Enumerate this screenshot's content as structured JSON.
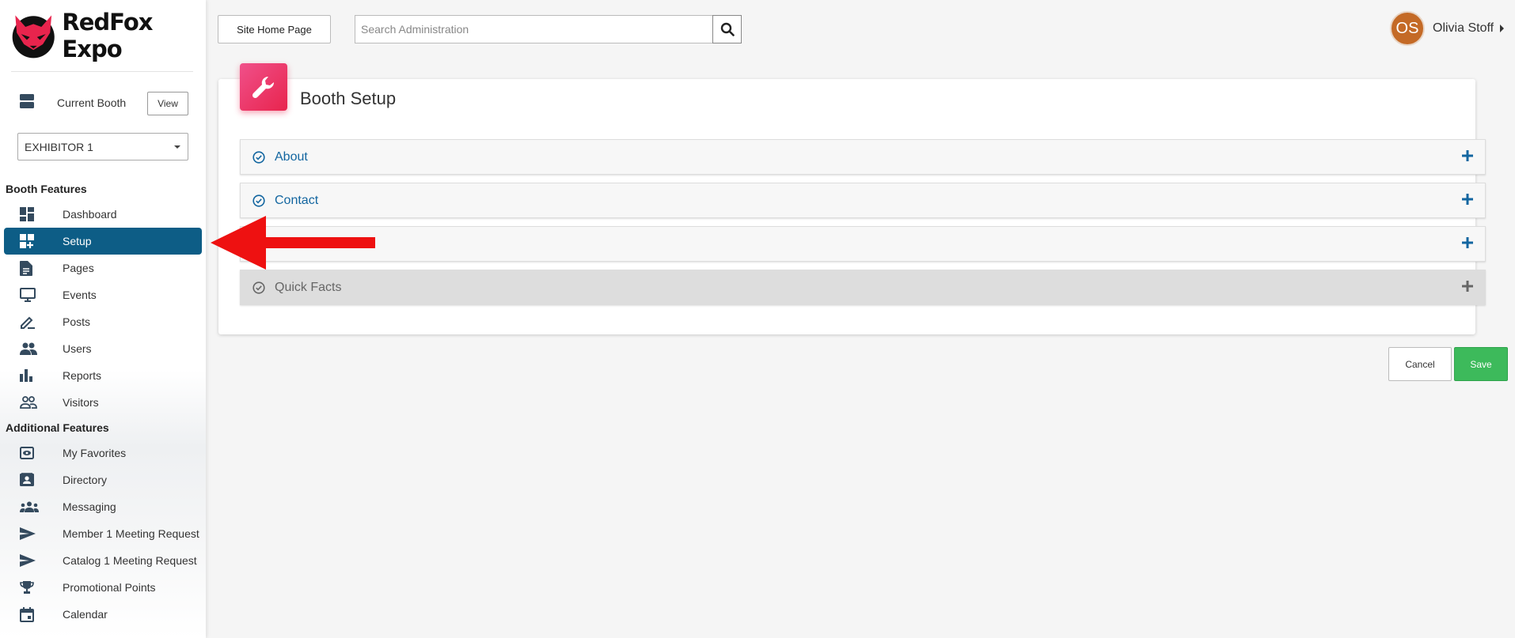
{
  "brand": {
    "name": "RedFox Expo",
    "logo_icon": "fox-head-logo",
    "accent": "#e8244d"
  },
  "sidebar": {
    "current_booth_label": "Current Booth",
    "view_label": "View",
    "booth_select_value": "EXHIBITOR 1",
    "booth_features_heading": "Booth Features",
    "booth_features": [
      {
        "label": "Dashboard",
        "icon": "dashboard-icon",
        "active": false
      },
      {
        "label": "Setup",
        "icon": "dashboard-add-icon",
        "active": true
      },
      {
        "label": "Pages",
        "icon": "document-icon",
        "active": false
      },
      {
        "label": "Events",
        "icon": "monitor-icon",
        "active": false
      },
      {
        "label": "Posts",
        "icon": "pen-icon",
        "active": false
      },
      {
        "label": "Users",
        "icon": "users-icon",
        "active": false
      },
      {
        "label": "Reports",
        "icon": "bar-chart-icon",
        "active": false
      },
      {
        "label": "Visitors",
        "icon": "visitors-icon",
        "active": false
      }
    ],
    "additional_features_heading": "Additional Features",
    "additional_features": [
      {
        "label": "My Favorites",
        "icon": "eye-icon"
      },
      {
        "label": "Directory",
        "icon": "contact-card-icon"
      },
      {
        "label": "Messaging",
        "icon": "group-icon"
      },
      {
        "label": "Member 1 Meeting Request",
        "icon": "send-icon"
      },
      {
        "label": "Catalog 1 Meeting Request",
        "icon": "send-icon"
      },
      {
        "label": "Promotional Points",
        "icon": "trophy-icon"
      },
      {
        "label": "Calendar",
        "icon": "calendar-icon"
      }
    ],
    "active_color": "#0d5d86"
  },
  "topbar": {
    "site_home_label": "Site Home Page",
    "search_placeholder": "Search Administration",
    "user_initials": "OS",
    "user_name": "Olivia Stoff",
    "avatar_color": "#c46a26"
  },
  "main": {
    "title": "Booth Setup",
    "title_icon": "wrench-icon",
    "sections": [
      {
        "label": "About",
        "enabled": true
      },
      {
        "label": "Contact",
        "enabled": true
      },
      {
        "label": "",
        "enabled": true
      },
      {
        "label": "Quick Facts",
        "enabled": false
      }
    ],
    "cancel_label": "Cancel",
    "save_label": "Save",
    "save_color": "#3dba5b"
  }
}
